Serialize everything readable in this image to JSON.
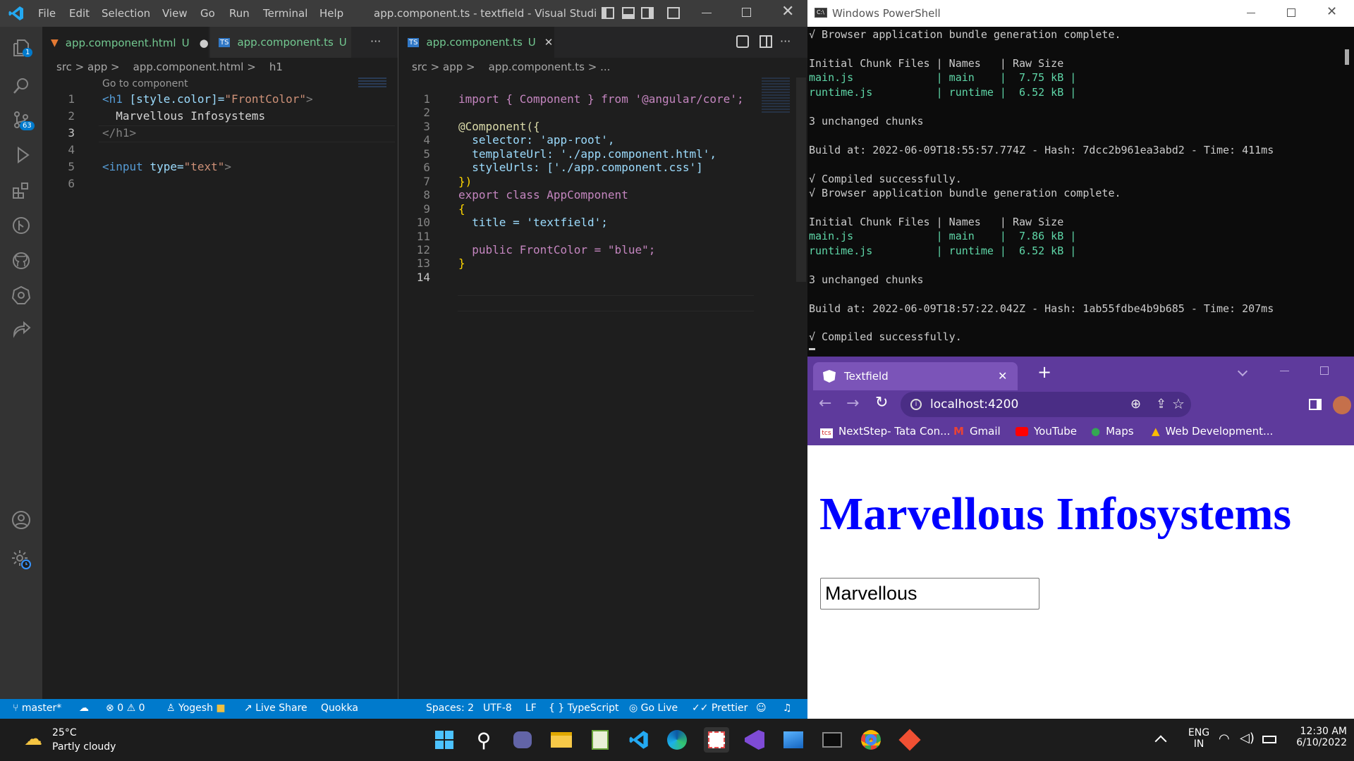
{
  "vscode": {
    "menu": [
      "File",
      "Edit",
      "Selection",
      "View",
      "Go",
      "Run",
      "Terminal",
      "Help"
    ],
    "window_title": "app.component.ts - textfield - Visual Studio C...",
    "activity_badges": {
      "explorer": "1",
      "scm": "63"
    },
    "left_pane": {
      "tab1": {
        "name": "app.component.html",
        "status": "U",
        "dot": "●"
      },
      "tab2": {
        "name": "app.component.ts",
        "status": "U"
      },
      "more": "···",
      "breadcrumb": "src > app >    app.component.html >    h1",
      "code_lens": "Go to component",
      "line_numbers": [
        "1",
        "2",
        "3",
        "4",
        "5",
        "6"
      ],
      "lines": [
        {
          "a": "<h1 ",
          "b": "[style.color]=",
          "c": "\"FrontColor\"",
          "d": ">"
        },
        {
          "text": "  Marvellous Infosystems"
        },
        {
          "text": "</h1>"
        },
        {
          "text": ""
        },
        {
          "a": "<input ",
          "b": "type=",
          "c": "\"text\"",
          "d": ">"
        },
        {
          "text": ""
        }
      ]
    },
    "right_pane": {
      "tab": {
        "name": "app.component.ts",
        "status": "U",
        "close": "✕"
      },
      "more": "···",
      "breadcrumb": "src > app >    app.component.ts > ...",
      "line_numbers": [
        "1",
        "2",
        "3",
        "4",
        "5",
        "6",
        "7",
        "8",
        "9",
        "10",
        "11",
        "12",
        "13",
        "14"
      ],
      "code": [
        "import { Component } from '@angular/core';",
        "",
        "@Component({",
        "  selector: 'app-root',",
        "  templateUrl: './app.component.html',",
        "  styleUrls: ['./app.component.css']",
        "})",
        "export class AppComponent",
        "{",
        "  title = 'textfield';",
        "",
        "  public FrontColor = \"blue\";",
        "}",
        ""
      ]
    },
    "statusbar": {
      "branch": "master*",
      "errors": "0",
      "warnings": "0",
      "user": "Yogesh",
      "live_share": "Live Share",
      "quokka": "Quokka",
      "spaces": "Spaces: 2",
      "encoding": "UTF-8",
      "eol": "LF",
      "language": "TypeScript",
      "go_live": "Go Live",
      "prettier": "Prettier"
    }
  },
  "powershell": {
    "title": "Windows PowerShell",
    "lines": [
      "√ Browser application bundle generation complete.",
      "",
      "Initial Chunk Files | Names   | Raw Size",
      "main.js             | main    |  7.75 kB |",
      "runtime.js          | runtime |  6.52 kB |",
      "",
      "3 unchanged chunks",
      "",
      "Build at: 2022-06-09T18:55:57.774Z - Hash: 7dcc2b961ea3abd2 - Time: 411ms",
      "",
      "√ Compiled successfully.",
      "√ Browser application bundle generation complete.",
      "",
      "Initial Chunk Files | Names   | Raw Size",
      "main.js             | main    |  7.86 kB |",
      "runtime.js          | runtime |  6.52 kB |",
      "",
      "3 unchanged chunks",
      "",
      "Build at: 2022-06-09T18:57:22.042Z - Hash: 1ab55fdbe4b9b685 - Time: 207ms",
      "",
      "√ Compiled successfully."
    ]
  },
  "chrome": {
    "tab_title": "Textfield",
    "tab_close": "✕",
    "new_tab": "+",
    "url": "localhost:4200",
    "bookmarks": [
      "NextStep- Tata Con...",
      "Gmail",
      "YouTube",
      "Maps",
      "Web Development..."
    ],
    "page": {
      "heading": "Marvellous Infosystems",
      "heading_color": "#0000ff",
      "input_value": "Marvellous"
    }
  },
  "taskbar": {
    "weather_temp": "25°C",
    "weather_desc": "Partly cloudy",
    "lang": "ENG",
    "region": "IN",
    "time": "12:30 AM",
    "date": "6/10/2022"
  }
}
